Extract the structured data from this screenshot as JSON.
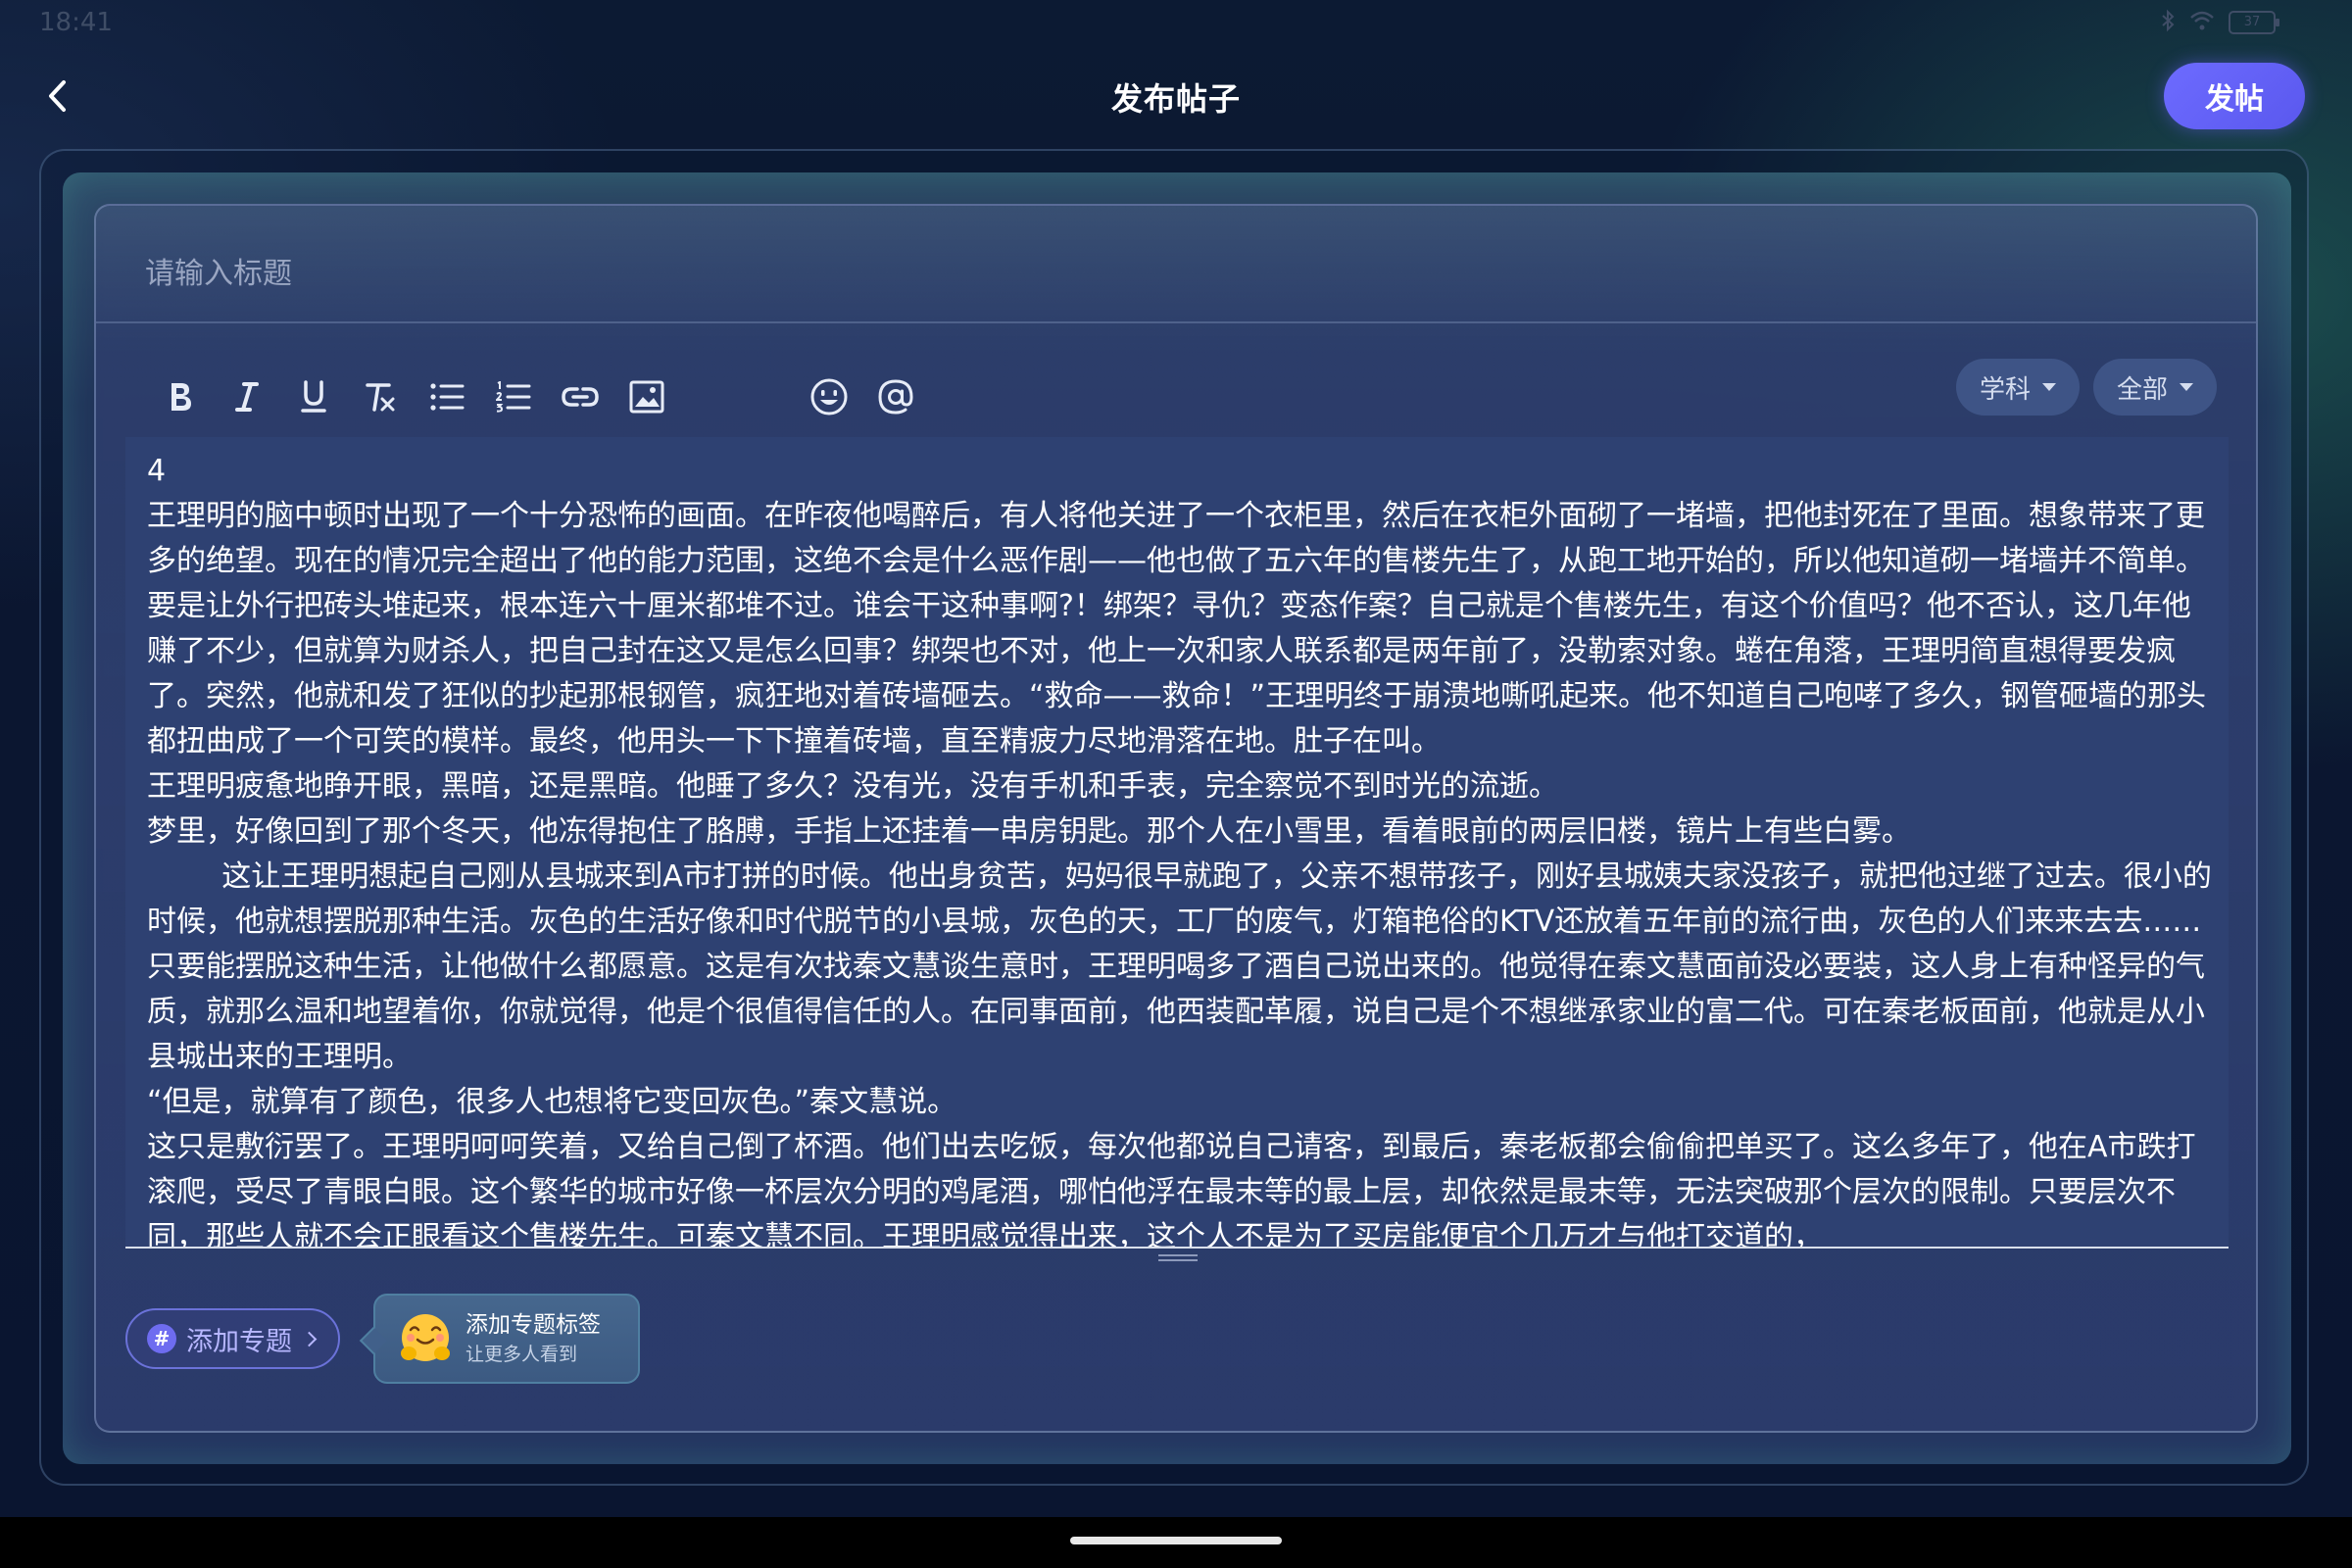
{
  "status_bar": {
    "time": "18:41",
    "battery": "37"
  },
  "header": {
    "title": "发布帖子",
    "post_label": "发帖"
  },
  "editor": {
    "title_placeholder": "请输入标题",
    "toolbar": {
      "icons": [
        "bold-icon",
        "italic-icon",
        "underline-icon",
        "clear-format-icon",
        "bullet-list-icon",
        "numbered-list-icon",
        "link-icon",
        "image-icon",
        "emoji-icon",
        "mention-icon"
      ]
    },
    "selects": {
      "subject": "学科",
      "scope": "全部"
    },
    "content": [
      "4",
      "王理明的脑中顿时出现了一个十分恐怖的画面。在昨夜他喝醉后，有人将他关进了一个衣柜里，然后在衣柜外面砌了一堵墙，把他封死在了里面。想象带来了更多的绝望。现在的情况完全超出了他的能力范围，这绝不会是什么恶作剧——他也做了五六年的售楼先生了，从跑工地开始的，所以他知道砌一堵墙并不简单。要是让外行把砖头堆起来，根本连六十厘米都堆不过。谁会干这种事啊?！绑架？寻仇？变态作案？自己就是个售楼先生，有这个价值吗？他不否认，这几年他赚了不少，但就算为财杀人，把自己封在这又是怎么回事？绑架也不对，他上一次和家人联系都是两年前了，没勒索对象。蜷在角落，王理明简直想得要发疯了。突然，他就和发了狂似的抄起那根钢管，疯狂地对着砖墙砸去。“救命——救命！”王理明终于崩溃地嘶吼起来。他不知道自己咆哮了多久，钢管砸墙的那头都扭曲成了一个可笑的模样。最终，他用头一下下撞着砖墙，直至精疲力尽地滑落在地。肚子在叫。",
      "王理明疲惫地睁开眼，黑暗，还是黑暗。他睡了多久？没有光，没有手机和手表，完全察觉不到时光的流逝。",
      "梦里，好像回到了那个冬天，他冻得抱住了胳膊，手指上还挂着一串房钥匙。那个人在小雪里，看着眼前的两层旧楼，镜片上有些白雾。",
      "        这让王理明想起自己刚从县城来到A市打拼的时候。他出身贫苦，妈妈很早就跑了，父亲不想带孩子，刚好县城姨夫家没孩子，就把他过继了过去。很小的时候，他就想摆脱那种生活。灰色的生活好像和时代脱节的小县城，灰色的天，工厂的废气，灯箱艳俗的KTV还放着五年前的流行曲，灰色的人们来来去去……只要能摆脱这种生活，让他做什么都愿意。这是有次找秦文慧谈生意时，王理明喝多了酒自己说出来的。他觉得在秦文慧面前没必要装，这人身上有种怪异的气质，就那么温和地望着你，你就觉得，他是个很值得信任的人。在同事面前，他西装配革履，说自己是个不想继承家业的富二代。可在秦老板面前，他就是从小县城出来的王理明。",
      "“但是，就算有了颜色，很多人也想将它变回灰色。”秦文慧说。",
      "这只是敷衍罢了。王理明呵呵笑着，又给自己倒了杯酒。他们出去吃饭，每次他都说自己请客，到最后，秦老板都会偷偷把单买了。这么多年了，他在A市跌打滚爬，受尽了青眼白眼。这个繁华的城市好像一杯层次分明的鸡尾酒，哪怕他浮在最末等的最上层，却依然是最末等，无法突破那个层次的限制。只要层次不同，那些人就不会正眼看这个售楼先生。可秦文慧不同。王理明感觉得出来，这个人不是为了买房能便宜个几万才与他打交道的，"
    ]
  },
  "topic": {
    "add_topic_label": "添加专题",
    "hash_symbol": "#",
    "tooltip_title": "添加专题标签",
    "tooltip_subtitle": "让更多人看到"
  },
  "colors": {
    "accent": "#6a68fb",
    "background": "#0b1630",
    "editor_bg": "#2e4172",
    "chip_bg": "#3e5486"
  }
}
